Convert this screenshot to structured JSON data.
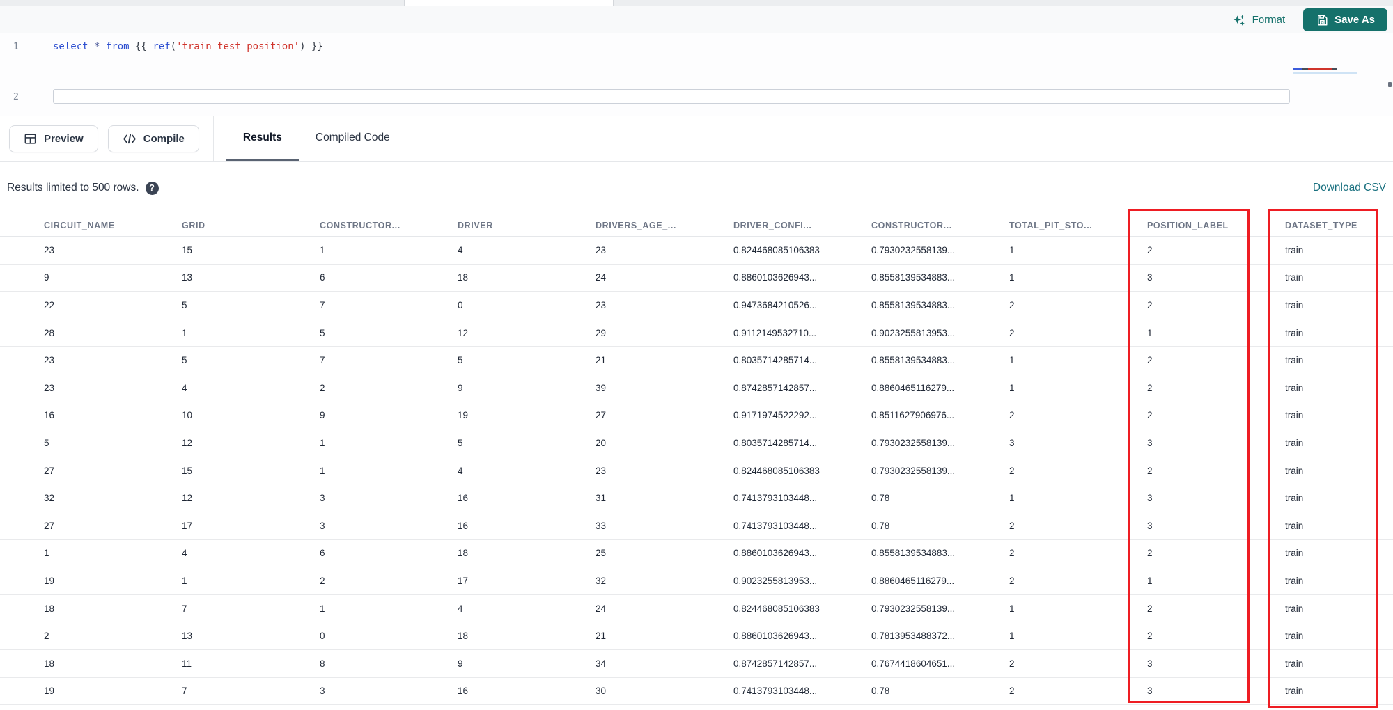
{
  "topbar": {
    "format_label": "Format",
    "save_as_label": "Save As"
  },
  "editor": {
    "lines": [
      {
        "number": "1",
        "tokens": [
          {
            "text": "select",
            "type": "keyword"
          },
          {
            "text": " ",
            "type": "plain"
          },
          {
            "text": "*",
            "type": "operator"
          },
          {
            "text": " ",
            "type": "plain"
          },
          {
            "text": "from",
            "type": "keyword"
          },
          {
            "text": " ",
            "type": "plain"
          },
          {
            "text": "{{ ",
            "type": "brace"
          },
          {
            "text": "ref",
            "type": "function"
          },
          {
            "text": "(",
            "type": "brace"
          },
          {
            "text": "'train_test_position'",
            "type": "string"
          },
          {
            "text": ")",
            "type": "brace"
          },
          {
            "text": " }}",
            "type": "brace"
          }
        ]
      },
      {
        "number": "2",
        "tokens": []
      }
    ]
  },
  "action_bar": {
    "preview_label": "Preview",
    "compile_label": "Compile"
  },
  "tabs": [
    {
      "label": "Results",
      "active": true
    },
    {
      "label": "Compiled Code",
      "active": false
    }
  ],
  "results_bar": {
    "info_text": "Results limited to 500 rows.",
    "help_icon": "?",
    "download_label": "Download CSV"
  },
  "table": {
    "columns": [
      "CIRCUIT_NAME",
      "GRID",
      "CONSTRUCTOR...",
      "DRIVER",
      "DRIVERS_AGE_...",
      "DRIVER_CONFI...",
      "CONSTRUCTOR...",
      "TOTAL_PIT_STO...",
      "POSITION_LABEL",
      "DATASET_TYPE"
    ],
    "highlighted_columns": [
      "POSITION_LABEL",
      "DATASET_TYPE"
    ],
    "rows": [
      [
        "23",
        "15",
        "1",
        "4",
        "23",
        "0.824468085106383",
        "0.7930232558139...",
        "1",
        "2",
        "train"
      ],
      [
        "9",
        "13",
        "6",
        "18",
        "24",
        "0.8860103626943...",
        "0.8558139534883...",
        "1",
        "3",
        "train"
      ],
      [
        "22",
        "5",
        "7",
        "0",
        "23",
        "0.9473684210526...",
        "0.8558139534883...",
        "2",
        "2",
        "train"
      ],
      [
        "28",
        "1",
        "5",
        "12",
        "29",
        "0.9112149532710...",
        "0.9023255813953...",
        "2",
        "1",
        "train"
      ],
      [
        "23",
        "5",
        "7",
        "5",
        "21",
        "0.8035714285714...",
        "0.8558139534883...",
        "1",
        "2",
        "train"
      ],
      [
        "23",
        "4",
        "2",
        "9",
        "39",
        "0.8742857142857...",
        "0.8860465116279...",
        "1",
        "2",
        "train"
      ],
      [
        "16",
        "10",
        "9",
        "19",
        "27",
        "0.9171974522292...",
        "0.8511627906976...",
        "2",
        "2",
        "train"
      ],
      [
        "5",
        "12",
        "1",
        "5",
        "20",
        "0.8035714285714...",
        "0.7930232558139...",
        "3",
        "3",
        "train"
      ],
      [
        "27",
        "15",
        "1",
        "4",
        "23",
        "0.824468085106383",
        "0.7930232558139...",
        "2",
        "2",
        "train"
      ],
      [
        "32",
        "12",
        "3",
        "16",
        "31",
        "0.7413793103448...",
        "0.78",
        "1",
        "3",
        "train"
      ],
      [
        "27",
        "17",
        "3",
        "16",
        "33",
        "0.7413793103448...",
        "0.78",
        "2",
        "3",
        "train"
      ],
      [
        "1",
        "4",
        "6",
        "18",
        "25",
        "0.8860103626943...",
        "0.8558139534883...",
        "2",
        "2",
        "train"
      ],
      [
        "19",
        "1",
        "2",
        "17",
        "32",
        "0.9023255813953...",
        "0.8860465116279...",
        "2",
        "1",
        "train"
      ],
      [
        "18",
        "7",
        "1",
        "4",
        "24",
        "0.824468085106383",
        "0.7930232558139...",
        "1",
        "2",
        "train"
      ],
      [
        "2",
        "13",
        "0",
        "18",
        "21",
        "0.8860103626943...",
        "0.7813953488372...",
        "1",
        "2",
        "train"
      ],
      [
        "18",
        "11",
        "8",
        "9",
        "34",
        "0.8742857142857...",
        "0.7674418604651...",
        "2",
        "3",
        "train"
      ],
      [
        "19",
        "7",
        "3",
        "16",
        "30",
        "0.7413793103448...",
        "0.78",
        "2",
        "3",
        "train"
      ]
    ]
  },
  "colors": {
    "accent_teal": "#15716b",
    "link_teal": "#19707f",
    "highlight_red": "#ee1d23",
    "keyword_blue": "#2e4fd0",
    "string_red": "#d0342c"
  }
}
